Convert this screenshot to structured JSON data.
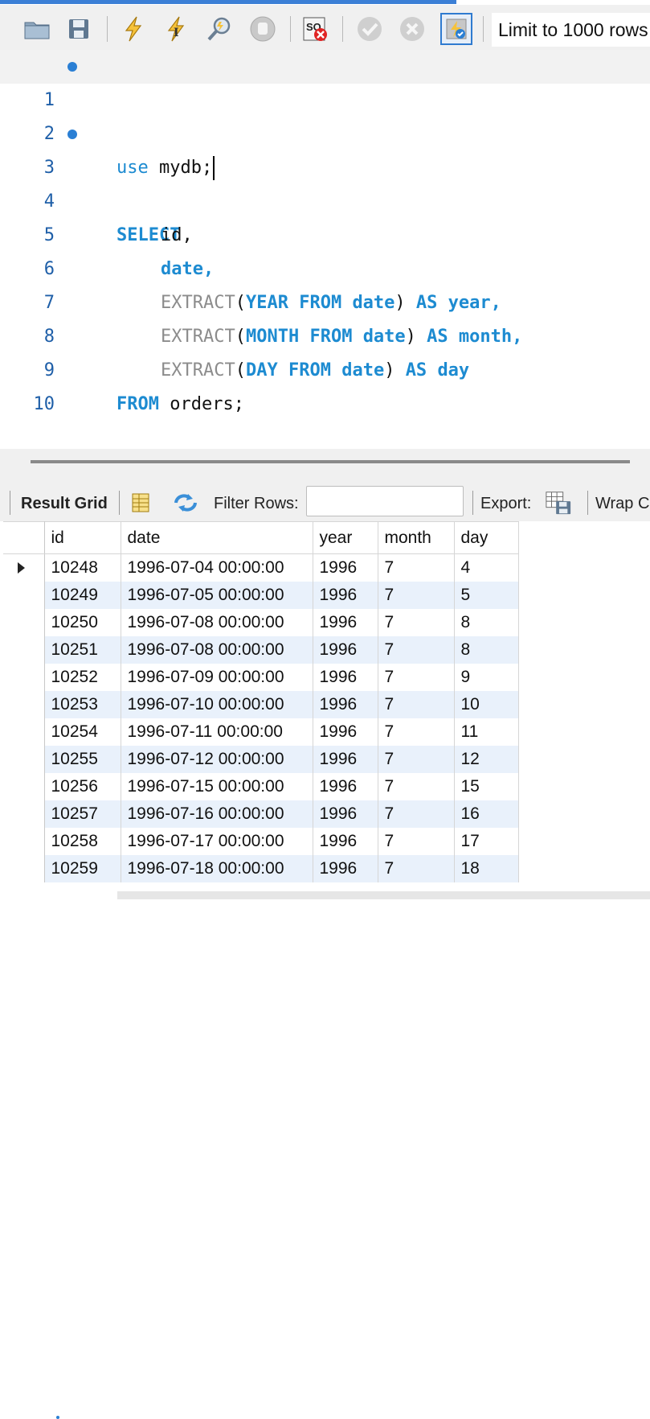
{
  "toolbar": {
    "limit_label": "Limit to 1000 rows",
    "icons": [
      "open-folder-icon",
      "save-icon",
      "execute-icon",
      "execute-current-icon",
      "explain-icon",
      "stop-icon",
      "toggle-error-icon",
      "commit-icon",
      "rollback-icon",
      "autocommit-icon"
    ]
  },
  "editor": {
    "lines": [
      {
        "num": "1",
        "marker": true
      },
      {
        "num": "2",
        "marker": false
      },
      {
        "num": "3",
        "marker": true
      },
      {
        "num": "4",
        "marker": false
      },
      {
        "num": "5",
        "marker": false
      },
      {
        "num": "6",
        "marker": false
      },
      {
        "num": "7",
        "marker": false
      },
      {
        "num": "8",
        "marker": false
      },
      {
        "num": "9",
        "marker": false
      },
      {
        "num": "10",
        "marker": false
      }
    ],
    "tokens": {
      "use": "use",
      "mydb": " mydb;",
      "select": "SELECT",
      "id": "id,",
      "date": "date,",
      "extract": "EXTRACT",
      "lp": "(",
      "rp": ")",
      "year_kw": "YEAR",
      "month_kw": "MONTH",
      "day_kw": "DAY",
      "from_kw": "FROM",
      "date_col": "date",
      "as_kw": "AS",
      "year_alias": "year,",
      "month_alias": "month,",
      "day_alias": "day",
      "orders": " orders;"
    }
  },
  "result_toolbar": {
    "result_grid": "Result Grid",
    "filter_rows": "Filter Rows:",
    "filter_value": "",
    "export": "Export:",
    "wrap": "Wrap C"
  },
  "grid": {
    "columns": [
      "id",
      "date",
      "year",
      "month",
      "day"
    ],
    "rows": [
      [
        "10248",
        "1996-07-04 00:00:00",
        "1996",
        "7",
        "4"
      ],
      [
        "10249",
        "1996-07-05 00:00:00",
        "1996",
        "7",
        "5"
      ],
      [
        "10250",
        "1996-07-08 00:00:00",
        "1996",
        "7",
        "8"
      ],
      [
        "10251",
        "1996-07-08 00:00:00",
        "1996",
        "7",
        "8"
      ],
      [
        "10252",
        "1996-07-09 00:00:00",
        "1996",
        "7",
        "9"
      ],
      [
        "10253",
        "1996-07-10 00:00:00",
        "1996",
        "7",
        "10"
      ],
      [
        "10254",
        "1996-07-11 00:00:00",
        "1996",
        "7",
        "11"
      ],
      [
        "10255",
        "1996-07-12 00:00:00",
        "1996",
        "7",
        "12"
      ],
      [
        "10256",
        "1996-07-15 00:00:00",
        "1996",
        "7",
        "15"
      ],
      [
        "10257",
        "1996-07-16 00:00:00",
        "1996",
        "7",
        "16"
      ],
      [
        "10258",
        "1996-07-17 00:00:00",
        "1996",
        "7",
        "17"
      ],
      [
        "10259",
        "1996-07-18 00:00:00",
        "1996",
        "7",
        "18"
      ]
    ]
  },
  "colors": {
    "accent": "#3b7fd6",
    "keyword": "#1d8bd1",
    "alt_row": "#e9f1fb"
  }
}
